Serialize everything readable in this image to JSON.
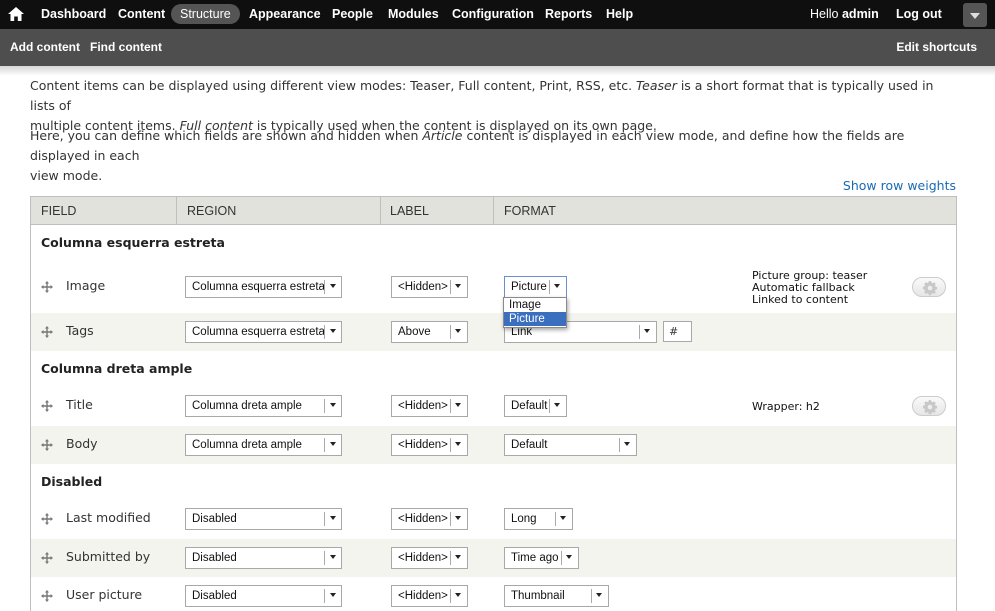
{
  "toolbar": {
    "menu": [
      "Dashboard",
      "Content",
      "Structure",
      "Appearance",
      "People",
      "Modules",
      "Configuration",
      "Reports",
      "Help"
    ],
    "hello_prefix": "Hello",
    "user": "admin",
    "logout": "Log out"
  },
  "shortcuts": {
    "add_content": "Add content",
    "find_content": "Find content",
    "edit": "Edit shortcuts"
  },
  "description": {
    "p1_a": "Content items can be displayed using different view modes: Teaser, Full content, Print, RSS, etc. ",
    "p1_teaser": "Teaser",
    "p1_b": " is a short format that is typically used in lists of",
    "p1_c": "multiple content items. ",
    "p1_full": "Full content",
    "p1_d": " is typically used when the content is displayed on its own page.",
    "p2_a": "Here, you can define which fields are shown and hidden when ",
    "p2_article": "Article",
    "p2_b": " content is displayed in each view mode, and define how the fields are displayed in each",
    "p2_c": "view mode."
  },
  "show_row_weights": "Show row weights",
  "table": {
    "headers": [
      "FIELD",
      "REGION",
      "LABEL",
      "FORMAT"
    ],
    "regions": [
      "Columna esquerra estreta",
      "Columna dreta ample",
      "Disabled"
    ],
    "rows": [
      {
        "field": "Image",
        "region": "Columna esquerra estreta",
        "label": "<Hidden>",
        "format": "Picture",
        "summary": [
          "Picture group: teaser",
          "Automatic fallback",
          "Linked to content"
        ]
      },
      {
        "field": "Tags",
        "region": "Columna esquerra estreta",
        "label": "Above",
        "format": "Link",
        "extra": "#"
      },
      {
        "field": "Title",
        "region": "Columna dreta ample",
        "label": "<Hidden>",
        "format": "Default",
        "summary": [
          "Wrapper: h2"
        ]
      },
      {
        "field": "Body",
        "region": "Columna dreta ample",
        "label": "<Hidden>",
        "format": "Default"
      },
      {
        "field": "Last modified",
        "region": "Disabled",
        "label": "<Hidden>",
        "format": "Long"
      },
      {
        "field": "Submitted by",
        "region": "Disabled",
        "label": "<Hidden>",
        "format": "Time ago"
      },
      {
        "field": "User picture",
        "region": "Disabled",
        "label": "<Hidden>",
        "format": "Thumbnail"
      }
    ]
  },
  "format_dropdown": {
    "options": [
      "Image",
      "Picture"
    ],
    "highlighted": "Picture"
  }
}
